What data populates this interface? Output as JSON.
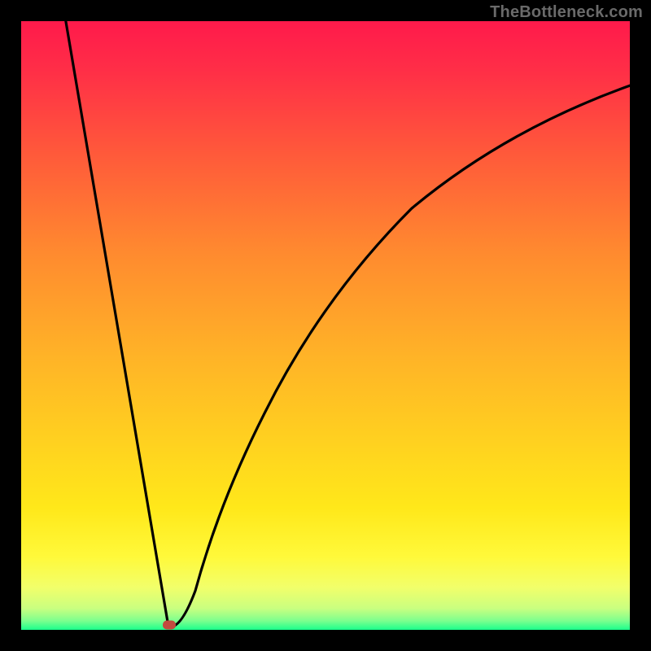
{
  "watermark": "TheBottleneck.com",
  "gradient_colors": {
    "c0": "#ff1a4b",
    "c1": "#ff2e47",
    "c2": "#ff5a3a",
    "c3": "#ff8a2f",
    "c4": "#ffb327",
    "c5": "#ffd31f",
    "c6": "#ffe81a",
    "c7": "#fff93a",
    "c8": "#f2ff6a",
    "c9": "#c9ff80",
    "c10": "#7dff8e",
    "c11": "#1bff8c"
  },
  "chart_data": {
    "type": "line",
    "title": "",
    "xlabel": "",
    "ylabel": "",
    "xlim": [
      0,
      100
    ],
    "ylim": [
      0,
      100
    ],
    "grid": false,
    "minimum": {
      "x": 24,
      "y": 0
    },
    "series": [
      {
        "name": "left-branch",
        "x": [
          10,
          12,
          14,
          16,
          18,
          20,
          22,
          23,
          24
        ],
        "values": [
          100,
          86,
          71,
          57,
          43,
          29,
          14,
          5,
          0
        ]
      },
      {
        "name": "right-branch",
        "x": [
          24,
          26,
          28,
          30,
          33,
          36,
          40,
          45,
          50,
          56,
          63,
          71,
          80,
          90,
          100
        ],
        "values": [
          0,
          10,
          20,
          29,
          38,
          46,
          54,
          61,
          67,
          72,
          77,
          81,
          84,
          87,
          90
        ]
      }
    ],
    "annotations": [
      {
        "kind": "marker",
        "x": 24,
        "y": 0,
        "color": "#c24a3f"
      }
    ]
  }
}
